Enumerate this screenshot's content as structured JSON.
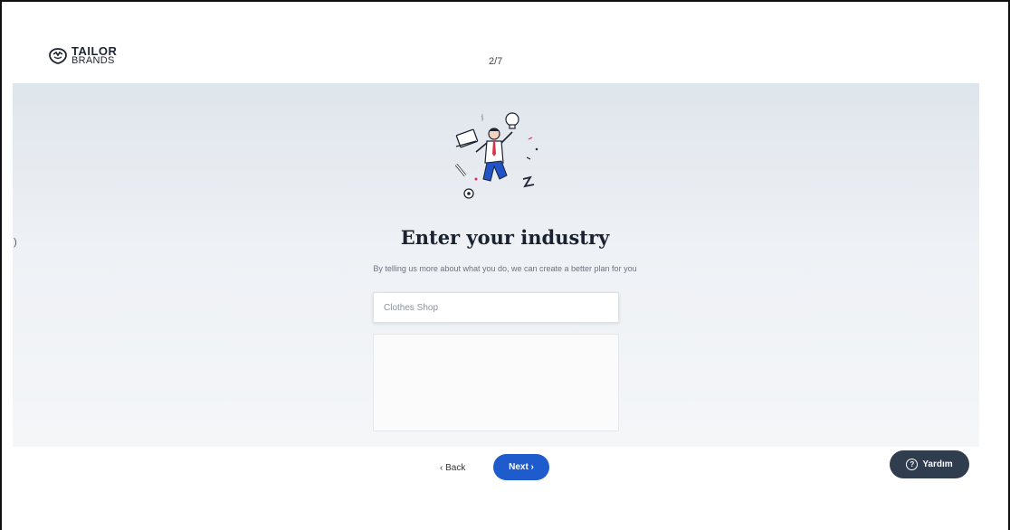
{
  "header": {
    "logo": {
      "line1": "TAILOR",
      "line2": "BRANDS"
    },
    "step_indicator": "2/7"
  },
  "main": {
    "side_chevron": ")",
    "title": "Enter your industry",
    "subtitle": "By telling us more about what you do, we can create a better plan for you",
    "industry_input": {
      "value": "",
      "placeholder": "Clothes Shop"
    }
  },
  "footer": {
    "back_label": "‹ Back",
    "next_label": "Next ›",
    "help_label": "Yardım",
    "help_icon": "question-circle-icon"
  },
  "colors": {
    "primary": "#1e5ccd",
    "help_button": "#2f3d4e",
    "background_top": "#dfe5ec"
  }
}
